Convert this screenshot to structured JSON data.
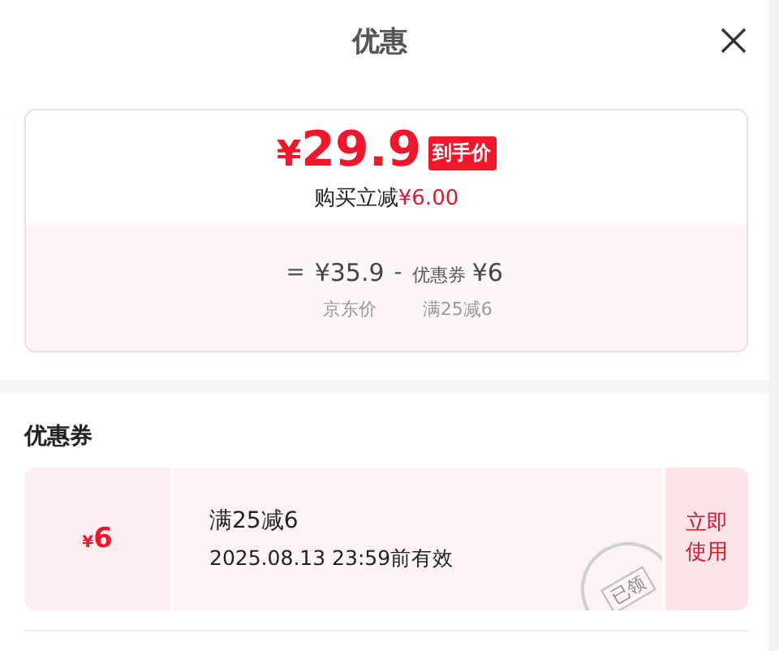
{
  "title": "优惠",
  "price": {
    "currency": "¥",
    "amount": "29.9",
    "tag": "到手价",
    "saving_label": "购买立减",
    "saving_value": "¥6.00"
  },
  "breakdown": {
    "equals": "=",
    "base": {
      "value": "¥35.9",
      "caption": "京东价"
    },
    "minus": "-",
    "discount": {
      "label": "优惠券",
      "value": "¥6",
      "caption": "满25减6"
    }
  },
  "coupons_heading": "优惠券",
  "coupons": [
    {
      "currency": "¥",
      "value": "6",
      "condition": "满25减6",
      "expiry": "2025.08.13 23:59前有效",
      "action": "立即使用",
      "claimed": true,
      "stamp": "已领"
    }
  ]
}
